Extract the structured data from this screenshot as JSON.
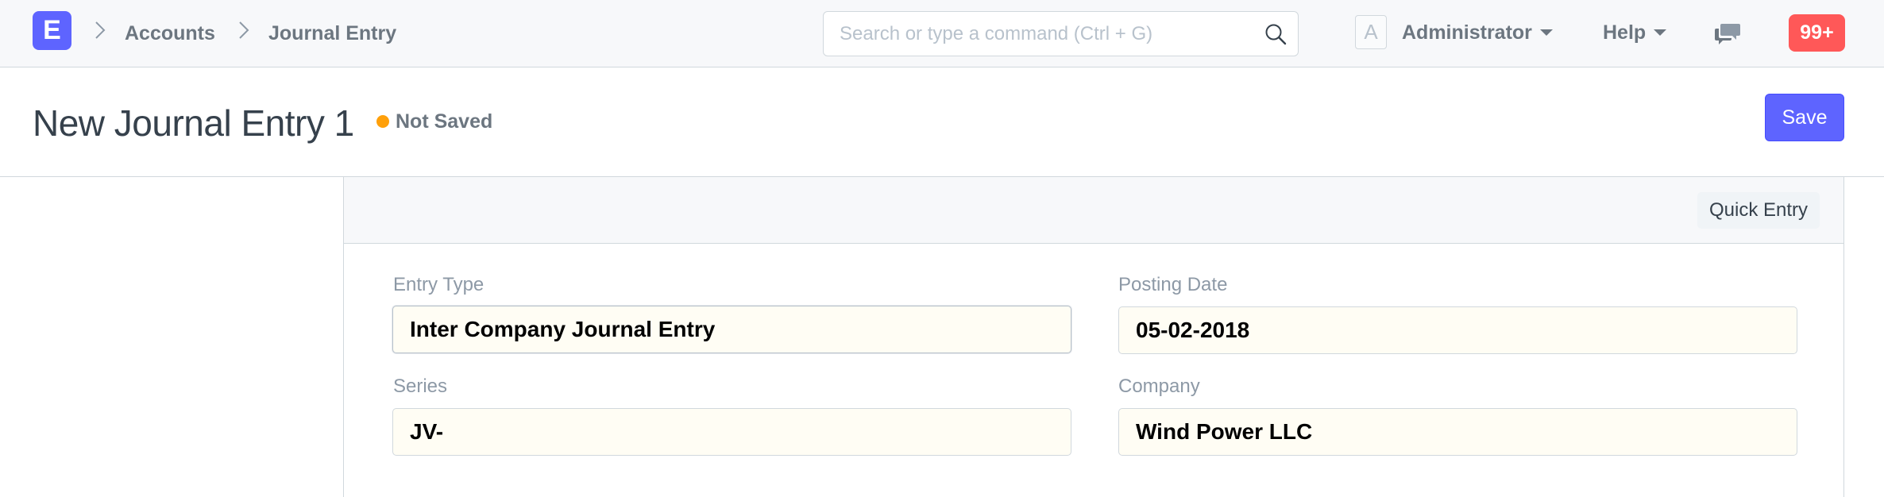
{
  "navbar": {
    "logo_letter": "E",
    "breadcrumbs": [
      "Accounts",
      "Journal Entry"
    ],
    "search": {
      "placeholder": "Search or type a command (Ctrl + G)",
      "value": ""
    },
    "avatar_letter": "A",
    "user_menu_label": "Administrator",
    "help_menu_label": "Help",
    "notification_count": "99+",
    "icons": {
      "search": "search-icon",
      "chat": "chat-icon",
      "caret": "caret-down-icon",
      "breadcrumb_sep": "chevron-right-icon"
    }
  },
  "page_head": {
    "title": "New Journal Entry 1",
    "status": "Not Saved",
    "status_color": "#ffa00a",
    "save_label": "Save",
    "accent_color": "#5e64ff"
  },
  "form": {
    "toolbar": {
      "quick_entry_label": "Quick Entry"
    },
    "fields": {
      "entry_type": {
        "label": "Entry Type",
        "value": "Inter Company Journal Entry"
      },
      "posting_date": {
        "label": "Posting Date",
        "value": "05-02-2018"
      },
      "series": {
        "label": "Series",
        "value": "JV-"
      },
      "company": {
        "label": "Company",
        "value": "Wind Power LLC"
      }
    }
  }
}
